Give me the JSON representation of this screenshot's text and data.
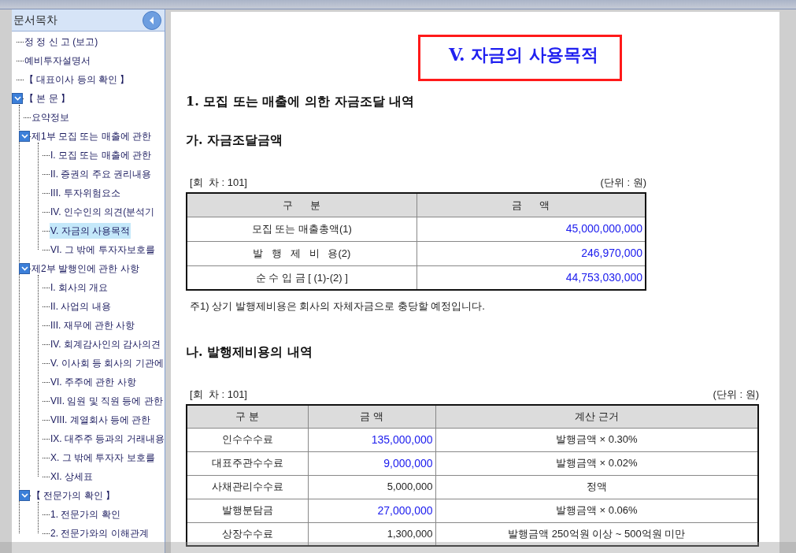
{
  "sidebar": {
    "title": "문서목차",
    "items": [
      {
        "label": "정 정 신 고 (보고)",
        "selected": false
      },
      {
        "label": "예비투자설명서",
        "selected": false
      },
      {
        "label": "【 대표이사 등의 확인 】",
        "selected": false
      },
      {
        "label": "【 본 문 】",
        "selected": false,
        "expanded": true,
        "children": [
          {
            "label": "요약정보",
            "selected": false
          },
          {
            "label": "제1부 모집 또는 매출에 관한",
            "selected": false,
            "expanded": true,
            "children": [
              {
                "label": "I. 모집 또는 매출에 관한",
                "selected": false
              },
              {
                "label": "II. 증권의 주요 권리내용",
                "selected": false
              },
              {
                "label": "III. 투자위험요소",
                "selected": false
              },
              {
                "label": "IV. 인수인의 의견(분석기",
                "selected": false
              },
              {
                "label": "V. 자금의 사용목적",
                "selected": true
              },
              {
                "label": "VI. 그 밖에 투자자보호를",
                "selected": false
              }
            ]
          },
          {
            "label": "제2부 발행인에 관한 사항",
            "selected": false,
            "expanded": true,
            "children": [
              {
                "label": "I. 회사의 개요",
                "selected": false
              },
              {
                "label": "II. 사업의 내용",
                "selected": false
              },
              {
                "label": "III. 재무에 관한 사항",
                "selected": false
              },
              {
                "label": "IV. 회계감사인의 감사의견",
                "selected": false
              },
              {
                "label": "V. 이사회 등 회사의 기관에",
                "selected": false
              },
              {
                "label": "VI. 주주에 관한 사항",
                "selected": false
              },
              {
                "label": "VII. 임원 및 직원 등에 관한",
                "selected": false
              },
              {
                "label": "VIII. 계열회사 등에 관한",
                "selected": false
              },
              {
                "label": "IX. 대주주 등과의 거래내용",
                "selected": false
              },
              {
                "label": "X. 그 밖에 투자자 보호를",
                "selected": false
              },
              {
                "label": "XI. 상세표",
                "selected": false
              }
            ]
          },
          {
            "label": "【 전문가의 확인 】",
            "selected": false,
            "expanded": true,
            "children": [
              {
                "label": "1. 전문가의 확인",
                "selected": false
              },
              {
                "label": "2. 전문가와의 이해관계",
                "selected": false
              }
            ]
          }
        ]
      }
    ]
  },
  "document": {
    "title": "V. 자금의 사용목적",
    "heading": "1. 모집 또는 매출에 의한 자금조달 내역",
    "funding": {
      "heading": "가. 자금조달금액",
      "round": "[회  차 : 101]",
      "unit": "(단위 : 원)",
      "columns": [
        "구      분",
        "금      액"
      ],
      "rows": [
        {
          "label": "모집 또는 매출총액(1)",
          "amount": "45,000,000,000",
          "amount_highlight": true
        },
        {
          "label": "발   행   제   비   용(2)",
          "amount": "246,970,000",
          "amount_highlight": true
        },
        {
          "label": "순 수 입 금 [ (1)-(2) ]",
          "amount": "44,753,030,000",
          "amount_highlight": true
        }
      ],
      "note": "주1) 상기 발행제비용은 회사의 자체자금으로 충당할 예정입니다."
    },
    "expenses": {
      "heading": "나. 발행제비용의 내역",
      "round": "[회  차 : 101]",
      "unit": "(단위 : 원)",
      "columns": [
        "구 분",
        "금 액",
        "계산 근거"
      ],
      "rows": [
        {
          "label": "인수수수료",
          "amount": "135,000,000",
          "amount_highlight": true,
          "basis": "발행금액 × 0.30%"
        },
        {
          "label": "대표주관수수료",
          "amount": "9,000,000",
          "amount_highlight": true,
          "basis": "발행금액 × 0.02%"
        },
        {
          "label": "사채관리수수료",
          "amount": "5,000,000",
          "amount_highlight": false,
          "basis": "정액"
        },
        {
          "label": "발행분담금",
          "amount": "27,000,000",
          "amount_highlight": true,
          "basis": "발행금액 × 0.06%"
        },
        {
          "label": "상장수수료",
          "amount": "1,300,000",
          "amount_highlight": false,
          "basis": "발행금액 250억원 이상 ~ 500억원 미만"
        }
      ]
    }
  }
}
